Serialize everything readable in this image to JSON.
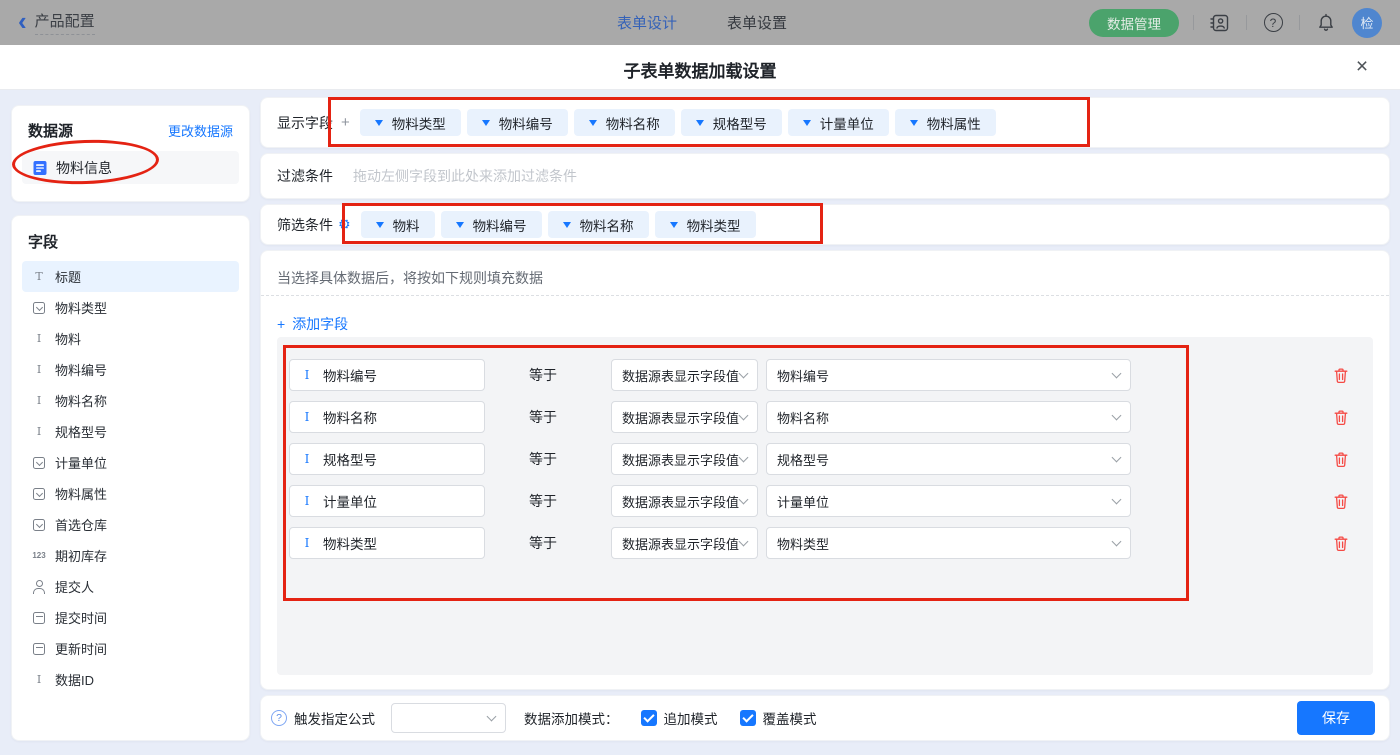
{
  "topbar": {
    "back_label": "产品配置",
    "tabs": [
      {
        "label": "表单设计"
      },
      {
        "label": "表单设置"
      }
    ],
    "data_manage_button": "数据管理",
    "avatar_text": "检"
  },
  "modal": {
    "title": "子表单数据加载设置",
    "close": "×"
  },
  "sidebar": {
    "datasource": {
      "title": "数据源",
      "change_link": "更改数据源",
      "selected_item": "物料信息"
    },
    "fields": {
      "title": "字段",
      "items": [
        {
          "label": "标题",
          "icon": "title-field-icon",
          "selected": true
        },
        {
          "label": "物料类型",
          "icon": "select-field-icon"
        },
        {
          "label": "物料",
          "icon": "text-field-icon"
        },
        {
          "label": "物料编号",
          "icon": "text-field-icon"
        },
        {
          "label": "物料名称",
          "icon": "text-field-icon"
        },
        {
          "label": "规格型号",
          "icon": "text-field-icon"
        },
        {
          "label": "计量单位",
          "icon": "select-field-icon"
        },
        {
          "label": "物料属性",
          "icon": "select-field-icon"
        },
        {
          "label": "首选仓库",
          "icon": "select-field-icon"
        },
        {
          "label": "期初库存",
          "icon": "number-field-icon"
        },
        {
          "label": "提交人",
          "icon": "person-field-icon"
        },
        {
          "label": "提交时间",
          "icon": "date-field-icon"
        },
        {
          "label": "更新时间",
          "icon": "date-field-icon"
        },
        {
          "label": "数据ID",
          "icon": "text-field-icon"
        }
      ]
    }
  },
  "main": {
    "display_fields": {
      "label": "显示字段",
      "tags": [
        "物料类型",
        "物料编号",
        "物料名称",
        "规格型号",
        "计量单位",
        "物料属性"
      ]
    },
    "filter": {
      "label": "过滤条件",
      "placeholder": "拖动左侧字段到此处来添加过滤条件"
    },
    "screening": {
      "label": "筛选条件",
      "tags": [
        "物料",
        "物料编号",
        "物料名称",
        "物料类型"
      ]
    },
    "hint": "当选择具体数据后，将按如下规则填充数据",
    "add_field_label": "添加字段",
    "mapping_rows": [
      {
        "field": "物料编号",
        "operator": "等于",
        "source": "数据源表显示字段值",
        "target": "物料编号"
      },
      {
        "field": "物料名称",
        "operator": "等于",
        "source": "数据源表显示字段值",
        "target": "物料名称"
      },
      {
        "field": "规格型号",
        "operator": "等于",
        "source": "数据源表显示字段值",
        "target": "规格型号"
      },
      {
        "field": "计量单位",
        "operator": "等于",
        "source": "数据源表显示字段值",
        "target": "计量单位"
      },
      {
        "field": "物料类型",
        "operator": "等于",
        "source": "数据源表显示字段值",
        "target": "物料类型"
      }
    ]
  },
  "footer": {
    "formula_label": "触发指定公式",
    "formula_value": "",
    "mode_label": "数据添加模式：",
    "modes": [
      {
        "label": "追加模式",
        "checked": true
      },
      {
        "label": "覆盖模式",
        "checked": true
      }
    ],
    "save_label": "保存"
  },
  "icons": {
    "back_chevron": "‹",
    "gear": "⚙",
    "help": "?",
    "plus": "+",
    "number": "123",
    "text_field": "I",
    "title_field": "T"
  },
  "colors": {
    "accent": "#1677ff",
    "annotation_red": "#e42313",
    "trash_red": "#f54a45",
    "tag_bg": "#e9f2fd",
    "green_button": "#4ba36c",
    "selected_item_bg": "#e9f3ff"
  }
}
